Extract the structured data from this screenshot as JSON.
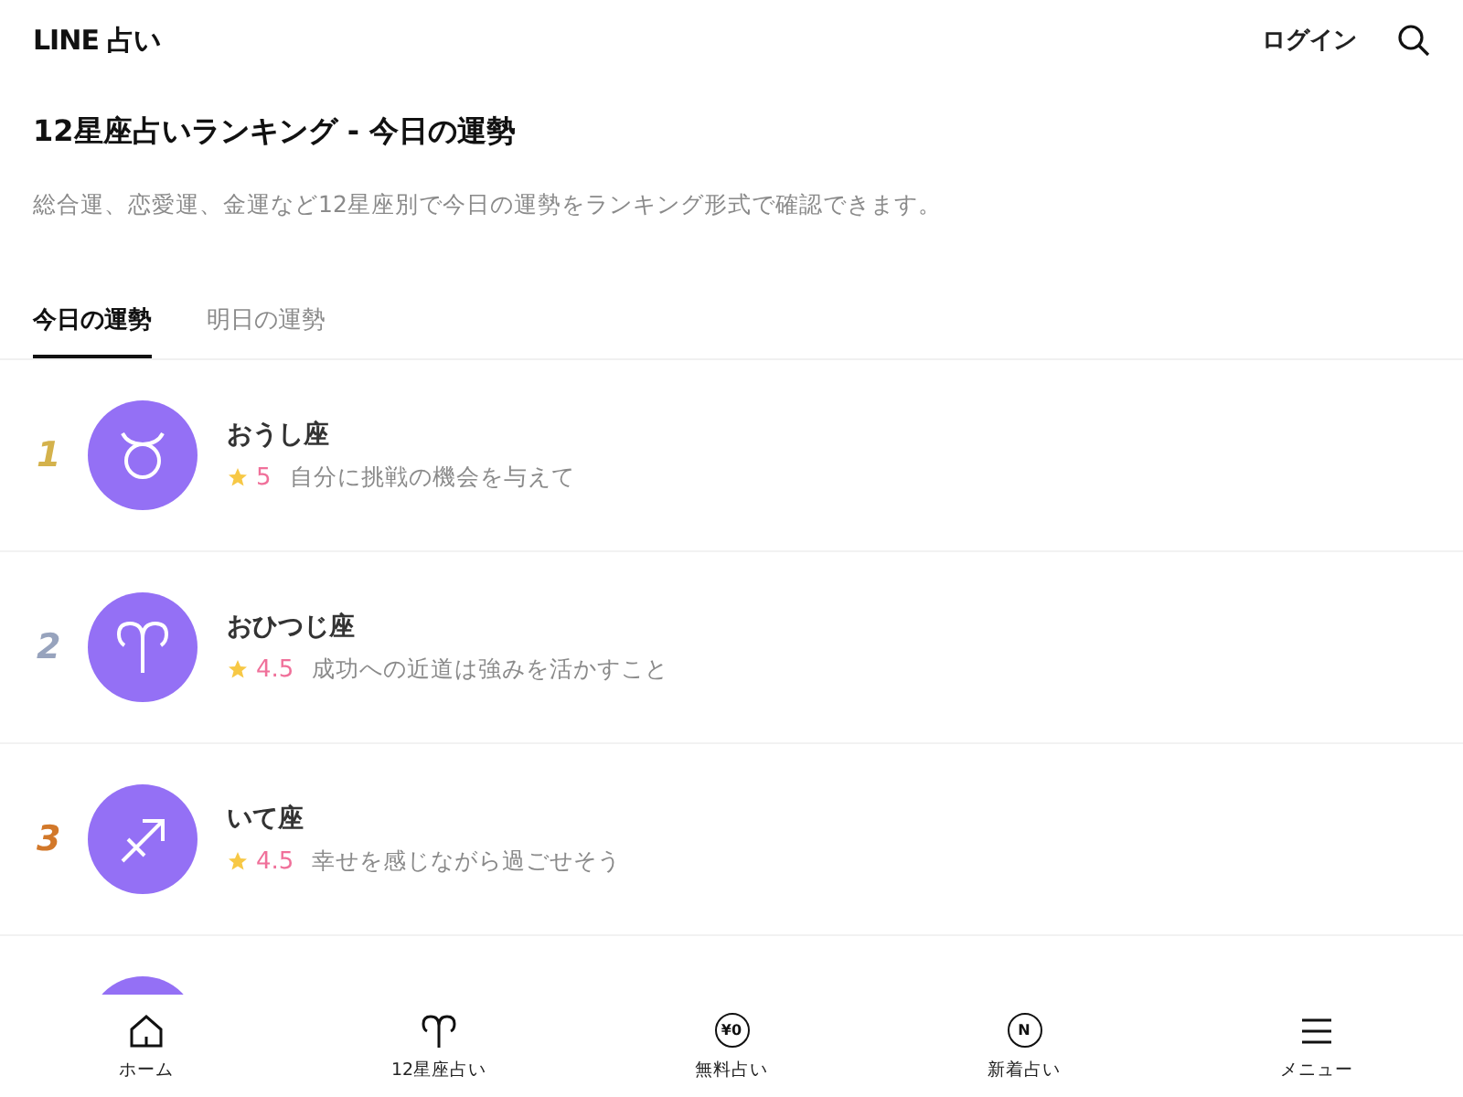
{
  "header": {
    "logo": "LINE 占い",
    "login": "ログイン"
  },
  "title": "12星座占いランキング - 今日の運勢",
  "description": "総合運、恋愛運、金運など12星座別で今日の運勢をランキング形式で確認できます。",
  "tabs": [
    {
      "label": "今日の運勢",
      "selected": true
    },
    {
      "label": "明日の運勢",
      "selected": false
    }
  ],
  "rows": [
    {
      "rank": "1",
      "color": "#d4b24c",
      "kind": "taurus",
      "name": "おうし座",
      "score": "5",
      "message": "自分に挑戦の機会を与えて"
    },
    {
      "rank": "2",
      "color": "#97a3bd",
      "kind": "aries",
      "name": "おひつじ座",
      "score": "4.5",
      "message": "成功への近道は強みを活かすこと"
    },
    {
      "rank": "3",
      "color": "#d2782a",
      "kind": "sagittarius",
      "name": "いて座",
      "score": "4.5",
      "message": "幸せを感じながら過ごせそう"
    },
    {
      "kind": "blank"
    }
  ],
  "bottom_nav": [
    {
      "kind": "home",
      "label": "ホーム"
    },
    {
      "kind": "aries",
      "label": "12星座占い"
    },
    {
      "kind": "circle",
      "icon_text": "¥0",
      "label": "無料占い"
    },
    {
      "kind": "circle",
      "icon_text": "N",
      "label": "新着占い"
    },
    {
      "kind": "menu",
      "label": "メニュー"
    }
  ]
}
